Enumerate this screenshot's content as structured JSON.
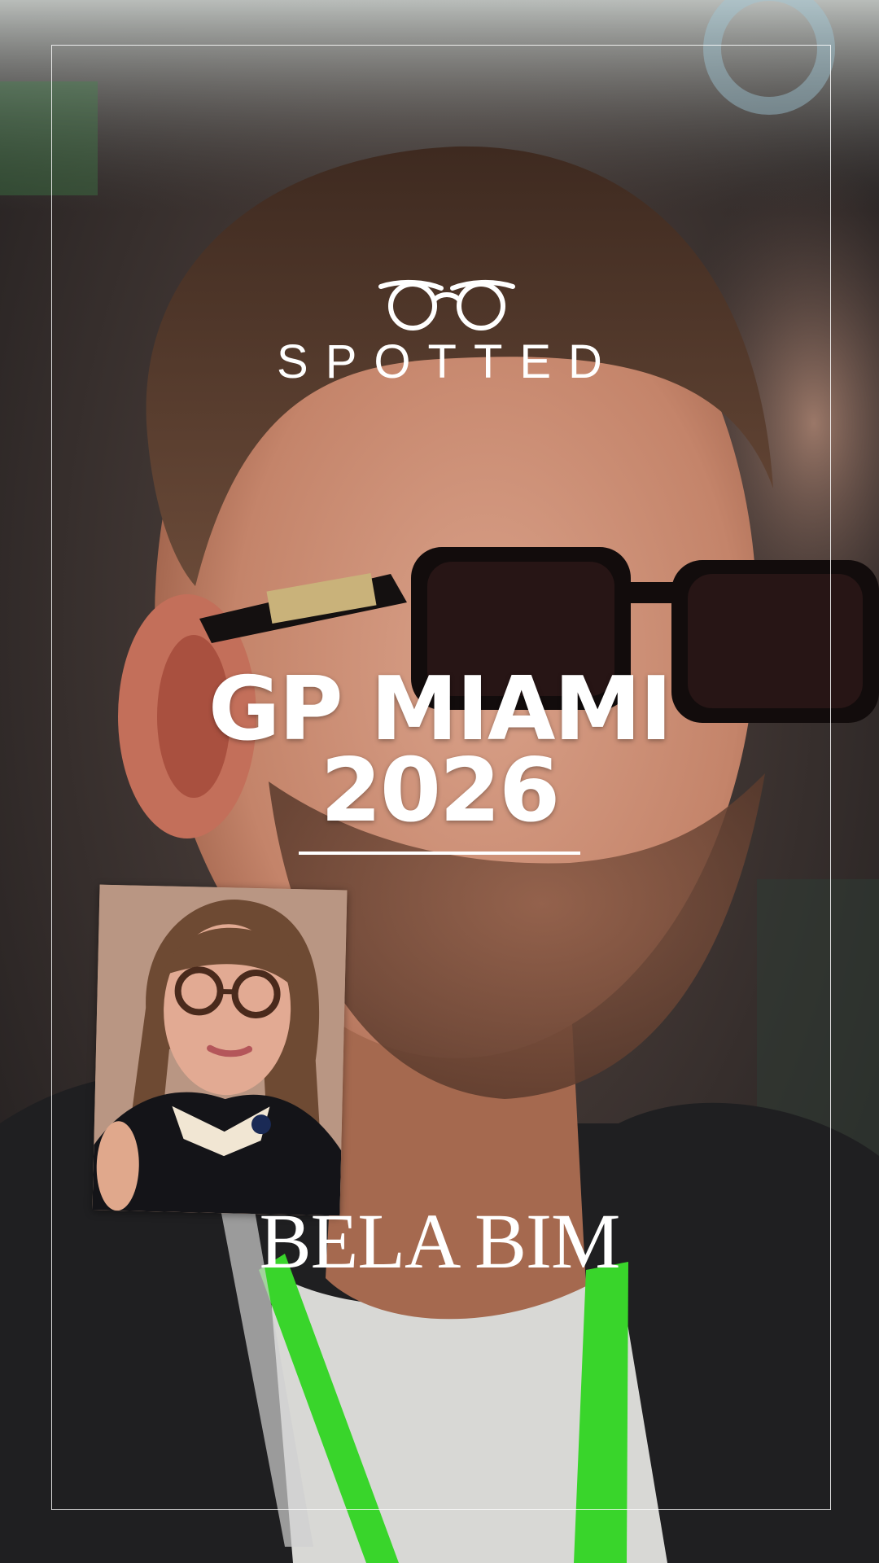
{
  "logo": {
    "icon": "glasses-icon",
    "name": "SPOTTED"
  },
  "headline": {
    "line1": "GP MIAMI",
    "line2": "2026"
  },
  "brand": {
    "name": "BELA BIM"
  },
  "colors": {
    "text": "#ffffff",
    "frame": "#ffffff",
    "lanyard": "#39d52b"
  }
}
